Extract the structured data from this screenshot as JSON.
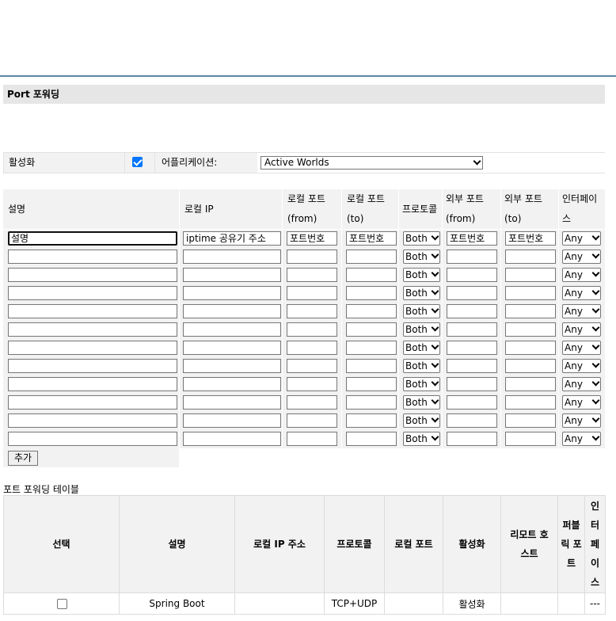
{
  "section_title": "Port 포워딩",
  "enable_row": {
    "enable_label": "활성화",
    "enabled": true,
    "application_label": "어플리케이션:",
    "application_value": "Active Worlds"
  },
  "rules": {
    "headers": {
      "desc": "설명",
      "local_ip": "로컬 IP",
      "local_port_from_1": "로컬 포트",
      "local_port_from_2": "(from)",
      "local_port_to_1": "로컬 포트",
      "local_port_to_2": "(to)",
      "protocol": "프로토콜",
      "ext_port_from_1": "외부 포트",
      "ext_port_from_2": "(from)",
      "ext_port_to_1": "외부 포트",
      "ext_port_to_2": "(to)",
      "interface_1": "인터페이",
      "interface_2": "스"
    },
    "first_row": {
      "desc": "설명",
      "local_ip": "iptime 공유기 주소",
      "local_from": "포트번호",
      "local_to": "포트번호",
      "ext_from": "포트번호",
      "ext_to": "포트번호"
    },
    "protocol_value": "Both",
    "interface_value": "Any",
    "add_button": "추가"
  },
  "forward_table": {
    "caption": "포트 포워딩 테이블",
    "headers": {
      "select": "선택",
      "desc": "설명",
      "local_ip": "로컬 IP 주소",
      "protocol": "프로토콜",
      "local_port": "로컬 포트",
      "enabled": "활성화",
      "remote_1": "리모트 호",
      "remote_2": "스트",
      "public_1": "퍼블",
      "public_2": "릭 포",
      "public_3": "트",
      "iface_1": "인",
      "iface_2": "터",
      "iface_3": "페",
      "iface_4": "이",
      "iface_5": "스"
    },
    "rows": [
      {
        "selected": false,
        "desc": "Spring Boot",
        "local_ip": "",
        "protocol": "TCP+UDP",
        "local_port": "",
        "enabled": "활성화",
        "remote_host": "",
        "public_port": "",
        "interface": "---"
      }
    ]
  }
}
